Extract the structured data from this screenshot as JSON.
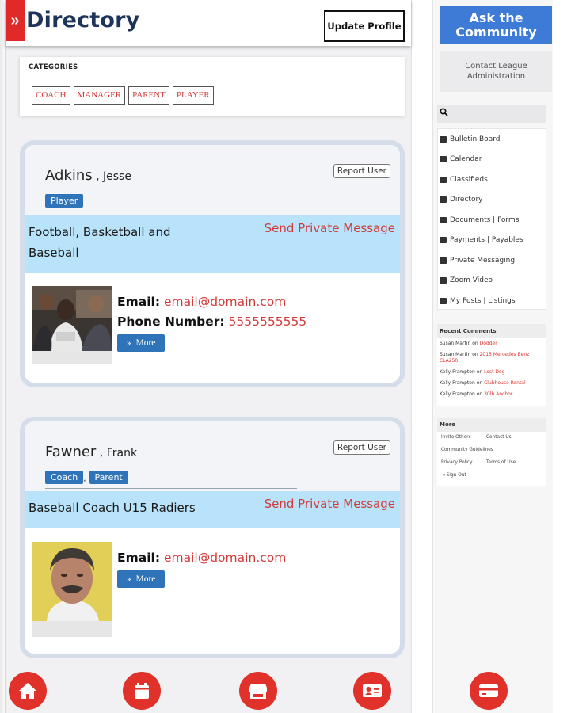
{
  "header": {
    "title": "Directory",
    "menu_glyph": "»",
    "update_profile_label": "Update Profile"
  },
  "categories": {
    "heading": "CATEGORIES",
    "items": [
      "COACH",
      "MANAGER",
      "PARENT",
      "PLAYER"
    ]
  },
  "members": [
    {
      "last_name": "Adkins",
      "first_name": "Jesse",
      "name_separator": ",",
      "report_label": "Report User",
      "roles": [
        "Player"
      ],
      "tagline": "Football, Basketball and Baseball",
      "send_message_label": "Send Private Message",
      "email_label": "Email:",
      "email": "email@domain.com",
      "phone_label": "Phone Number:",
      "phone": "5555555555",
      "more_label": "More"
    },
    {
      "last_name": "Fawner",
      "first_name": "Frank",
      "name_separator": ",",
      "report_label": "Report User",
      "roles": [
        "Coach",
        "Parent"
      ],
      "role_separator": ",",
      "tagline": "Baseball Coach U15 Radiers",
      "send_message_label": "Send Private Message",
      "email_label": "Email:",
      "email": "email@domain.com",
      "more_label": "More"
    }
  ],
  "bottom_nav": {
    "items": [
      "home-icon",
      "calendar-icon",
      "store-icon",
      "contact-card-icon",
      "credit-card-icon"
    ],
    "accent": "#e0312b"
  },
  "sidebar": {
    "ask_label": "Ask the Community",
    "contact_label": "Contact League Administration",
    "nav_items": [
      {
        "label": "Bulletin Board",
        "icon": "newspaper-icon"
      },
      {
        "label": "Calendar",
        "icon": "calendar-icon"
      },
      {
        "label": "Classifieds",
        "icon": "shop-icon"
      },
      {
        "label": "Directory",
        "icon": "address-card-icon"
      },
      {
        "label": "Documents | Forms",
        "icon": "document-icon"
      },
      {
        "label": "Payments | Payables",
        "icon": "credit-card-icon"
      },
      {
        "label": "Private Messaging",
        "icon": "chat-icon"
      },
      {
        "label": "Zoom Video",
        "icon": "video-icon"
      },
      {
        "label": "My Posts | Listings",
        "icon": "list-icon"
      }
    ],
    "recent_heading": "Recent Comments",
    "recent": [
      {
        "author": "Susan Martin",
        "on": "on",
        "target": "Dodder"
      },
      {
        "author": "Susan Martin",
        "on": "on",
        "target": "2015 Mercedes Benz CLA250"
      },
      {
        "author": "Kelly Frampton",
        "on": "on",
        "target": "Lost Dog"
      },
      {
        "author": "Kelly Frampton",
        "on": "on",
        "target": "Clubhouse Rental"
      },
      {
        "author": "Kelly Frampton",
        "on": "on",
        "target": "30lb Anchor"
      }
    ],
    "more_heading": "More",
    "more_links": [
      "Invite Others",
      "Contact Us",
      "Community Guidelines",
      "Privacy Policy",
      "Terms of Use",
      "Sign Out"
    ]
  },
  "colors": {
    "brand_red": "#e0312b",
    "title_navy": "#1e3559",
    "role_blue": "#2f73b8",
    "band_blue": "#b8e3fb",
    "link_red": "#d13a3a",
    "ask_blue": "#3d7bd6"
  }
}
